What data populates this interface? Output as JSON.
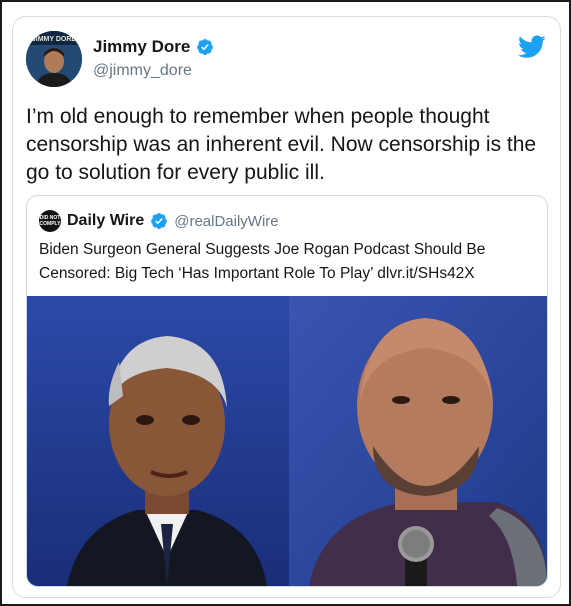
{
  "tweet": {
    "author_name": "Jimmy Dore",
    "author_handle": "@jimmy_dore",
    "avatar_caption": "JIMMY DORE",
    "text": "I’m old enough to remember when people thought censorship was an inherent evil. Now censorship is the go to solution for every public ill."
  },
  "quoted_tweet": {
    "author_name": "Daily Wire",
    "author_handle": "@realDailyWire",
    "avatar_text": "DID NOT COMPLY",
    "text": "Biden Surgeon General Suggests Joe Rogan Podcast Should Be Censored: Big Tech ‘Has Important Role To Play’ dlvr.it/SHs42X"
  },
  "icons": {
    "verified": "verified-badge-icon",
    "brand": "twitter-bird-icon"
  },
  "colors": {
    "brand_blue": "#1da1f2",
    "text": "#14171a",
    "secondary_text": "#657786",
    "border": "#cfd9de"
  }
}
